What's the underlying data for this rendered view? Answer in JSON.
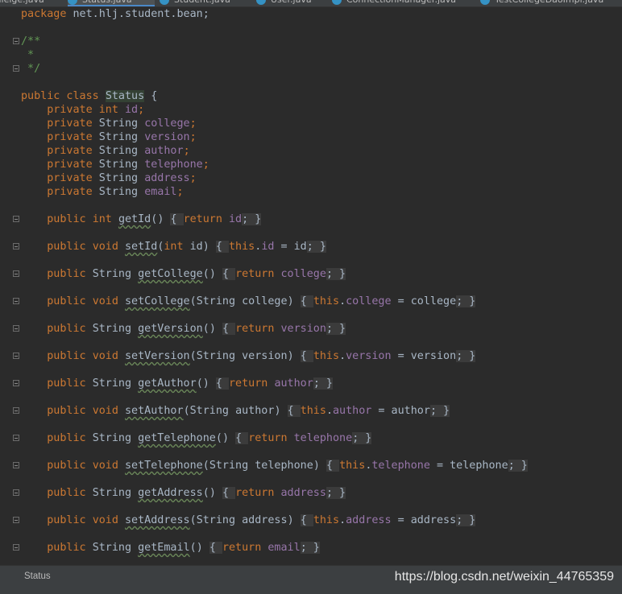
{
  "tabs": [
    {
      "label": "...lleige.java",
      "active": false
    },
    {
      "label": "Status.java",
      "active": true
    },
    {
      "label": "Student.java",
      "active": false
    },
    {
      "label": "User.java",
      "active": false
    },
    {
      "label": "ConnectionManager.java",
      "active": false
    },
    {
      "label": "TestCollegeDaoImpl.java",
      "active": false
    }
  ],
  "code": {
    "package_kw": "package",
    "package_name": "net.hlj.student.bean;",
    "comment_open": "/**",
    "comment_star": " *",
    "comment_close": " */",
    "class_decl": {
      "mod": "public",
      "kw": "class",
      "name": "Status",
      "brace": " {"
    },
    "fields": [
      {
        "mod": "private",
        "type": "int",
        "name": "id"
      },
      {
        "mod": "private",
        "type": "String",
        "name": "college"
      },
      {
        "mod": "private",
        "type": "String",
        "name": "version"
      },
      {
        "mod": "private",
        "type": "String",
        "name": "author"
      },
      {
        "mod": "private",
        "type": "String",
        "name": "telephone"
      },
      {
        "mod": "private",
        "type": "String",
        "name": "address"
      },
      {
        "mod": "private",
        "type": "String",
        "name": "email"
      }
    ],
    "methods": [
      {
        "ret": "int",
        "name": "getId",
        "kind": "get",
        "field": "id",
        "param_type": "",
        "param": ""
      },
      {
        "ret": "void",
        "name": "setId",
        "kind": "set",
        "field": "id",
        "param_type": "int",
        "param": "id"
      },
      {
        "ret": "String",
        "name": "getCollege",
        "kind": "get",
        "field": "college",
        "param_type": "",
        "param": ""
      },
      {
        "ret": "void",
        "name": "setCollege",
        "kind": "set",
        "field": "college",
        "param_type": "String",
        "param": "college"
      },
      {
        "ret": "String",
        "name": "getVersion",
        "kind": "get",
        "field": "version",
        "param_type": "",
        "param": ""
      },
      {
        "ret": "void",
        "name": "setVersion",
        "kind": "set",
        "field": "version",
        "param_type": "String",
        "param": "version"
      },
      {
        "ret": "String",
        "name": "getAuthor",
        "kind": "get",
        "field": "author",
        "param_type": "",
        "param": ""
      },
      {
        "ret": "void",
        "name": "setAuthor",
        "kind": "set",
        "field": "author",
        "param_type": "String",
        "param": "author"
      },
      {
        "ret": "String",
        "name": "getTelephone",
        "kind": "get",
        "field": "telephone",
        "param_type": "",
        "param": ""
      },
      {
        "ret": "void",
        "name": "setTelephone",
        "kind": "set",
        "field": "telephone",
        "param_type": "String",
        "param": "telephone"
      },
      {
        "ret": "String",
        "name": "getAddress",
        "kind": "get",
        "field": "address",
        "param_type": "",
        "param": ""
      },
      {
        "ret": "void",
        "name": "setAddress",
        "kind": "set",
        "field": "address",
        "param_type": "String",
        "param": "address"
      },
      {
        "ret": "String",
        "name": "getEmail",
        "kind": "get",
        "field": "email",
        "param_type": "",
        "param": ""
      }
    ]
  },
  "statusbar": {
    "label": "Status",
    "watermark": "https://blog.csdn.net/weixin_44765359"
  },
  "colors": {
    "background": "#2b2b2b",
    "keyword": "#cc7832",
    "field": "#9876aa",
    "comment": "#629755",
    "text": "#a9b7c6"
  },
  "icons": {
    "fold": "fold-marker-icon",
    "tab": "java-class-icon"
  }
}
